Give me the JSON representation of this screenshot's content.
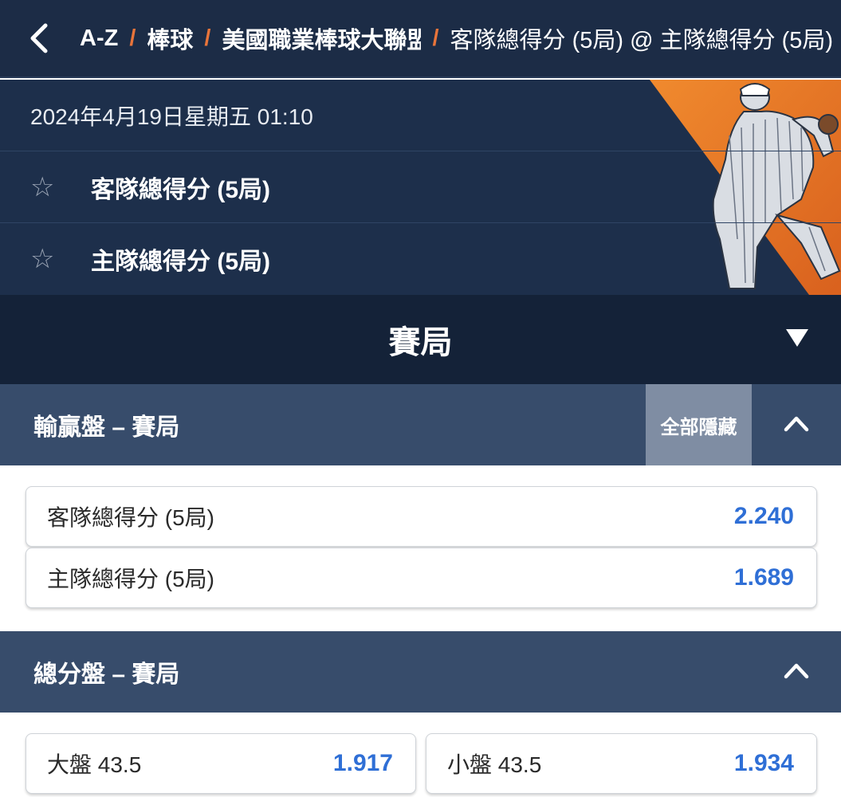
{
  "nav": {
    "crumbs": [
      "A-Z",
      "棒球",
      "美國職業棒球大聯盟",
      "客隊總得分 (5局) @ 主隊總得分 (5局)"
    ]
  },
  "event": {
    "datetime": "2024年4月19日星期五 01:10",
    "away_team": "客隊總得分 (5局)",
    "home_team": "主隊總得分 (5局)"
  },
  "selector": {
    "title": "賽局"
  },
  "markets": [
    {
      "title": "輸贏盤 – 賽局",
      "hide_all_label": "全部隱藏",
      "selections": [
        {
          "label": "客隊總得分 (5局)",
          "odds": "2.240"
        },
        {
          "label": "主隊總得分 (5局)",
          "odds": "1.689"
        }
      ]
    },
    {
      "title": "總分盤 – 賽局",
      "selections": [
        {
          "label": "大盤 43.5",
          "odds": "1.917"
        },
        {
          "label": "小盤 43.5",
          "odds": "1.934"
        }
      ]
    }
  ],
  "icons": {
    "back": "chevron-left-icon",
    "favorite": "star-outline-icon",
    "dropdown": "triangle-down-icon",
    "collapse": "chevron-up-icon"
  },
  "colors": {
    "nav_bg": "#1c2c46",
    "accent_separator": "#e8743a",
    "market_header": "#374c6b",
    "odds": "#2f6fd6"
  }
}
